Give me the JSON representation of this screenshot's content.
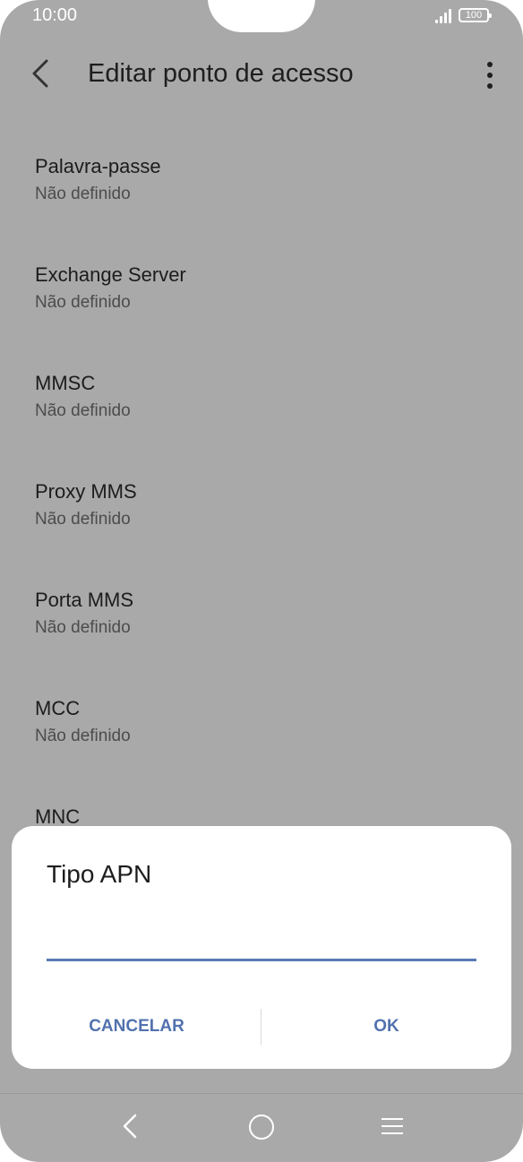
{
  "status_bar": {
    "time": "10:00",
    "battery": "100"
  },
  "header": {
    "title": "Editar ponto de acesso"
  },
  "settings": [
    {
      "title": "Palavra-passe",
      "value": "Não definido"
    },
    {
      "title": "Exchange Server",
      "value": "Não definido"
    },
    {
      "title": "MMSC",
      "value": "Não definido"
    },
    {
      "title": "Proxy MMS",
      "value": "Não definido"
    },
    {
      "title": "Porta MMS",
      "value": "Não definido"
    },
    {
      "title": "MCC",
      "value": "Não definido"
    },
    {
      "title": "MNC",
      "value": ""
    }
  ],
  "dialog": {
    "title": "Tipo APN",
    "input_value": "",
    "cancel_label": "CANCELAR",
    "ok_label": "OK"
  },
  "colors": {
    "accent": "#5272ae",
    "scrim": "#a9a9a9"
  }
}
